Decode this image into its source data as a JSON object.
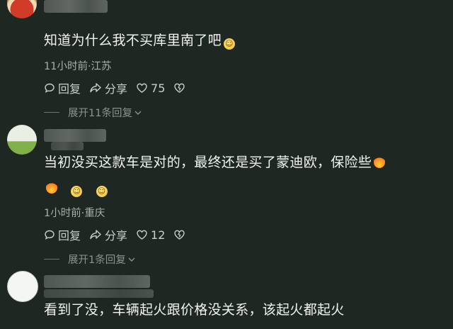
{
  "comments": [
    {
      "text": "知道为什么我不买库里南了吧",
      "time_location": "11小时前·江苏",
      "reply_label": "回复",
      "share_label": "分享",
      "like_count": "75",
      "expand_label": "展开11条回复"
    },
    {
      "text": "当初没买这款车是对的，最终还是买了蒙迪欧，保险些",
      "time_location": "1小时前·重庆",
      "reply_label": "回复",
      "share_label": "分享",
      "like_count": "12",
      "expand_label": "展开1条回复"
    },
    {
      "text": "看到了没，车辆起火跟价格没关系，该起火都起火"
    }
  ],
  "icons": {
    "reply": "speech-bubble-icon",
    "share": "share-arrow-icon",
    "like": "heart-icon",
    "dislike": "broken-heart-icon",
    "expand": "chevron-down-icon"
  },
  "colors": {
    "background": "#1f2723",
    "text": "#f2f4f2",
    "meta": "#a9b0ab"
  }
}
